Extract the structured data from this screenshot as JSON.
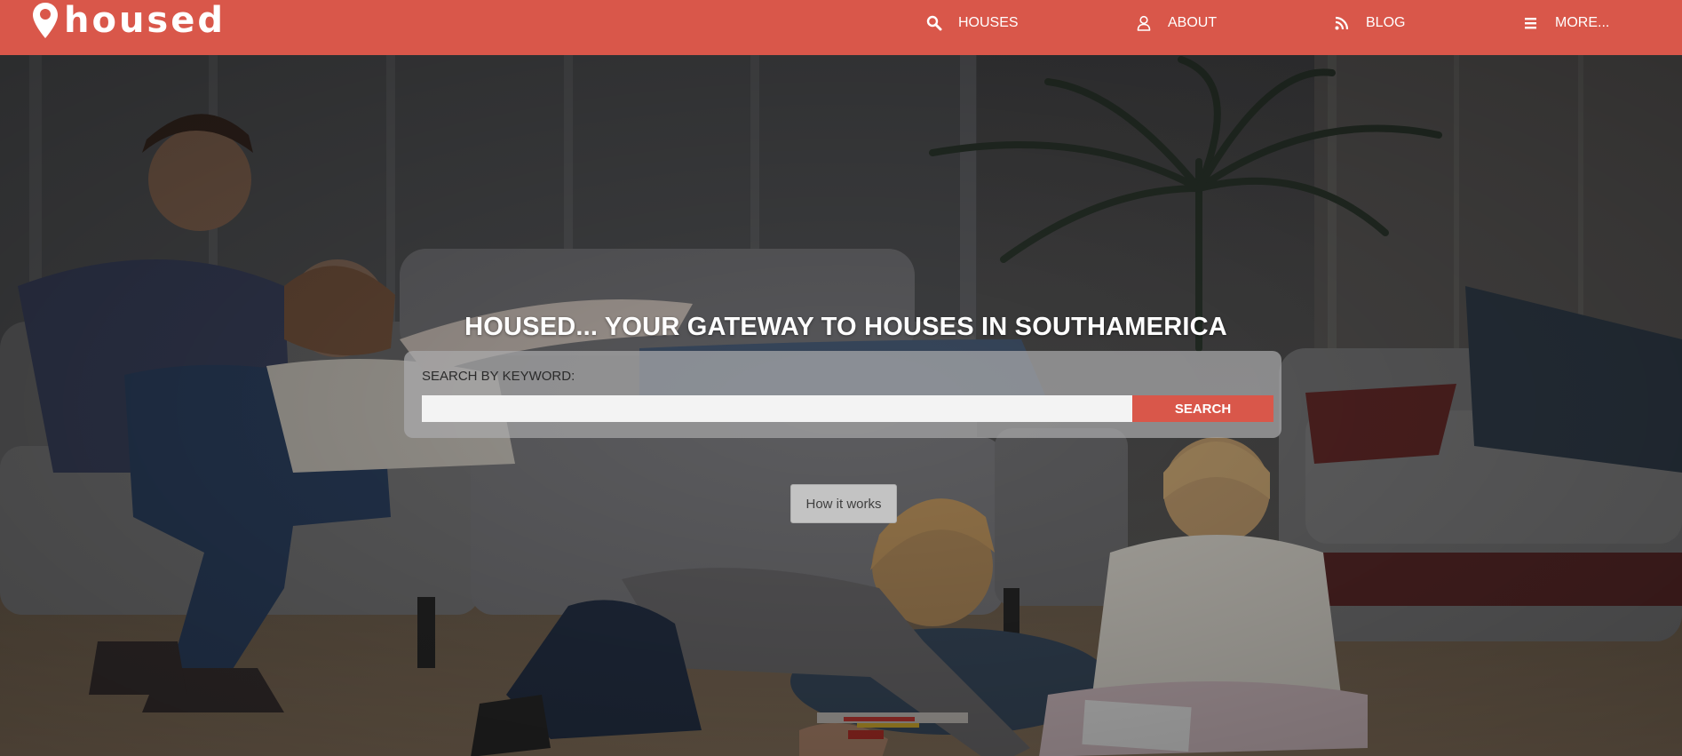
{
  "brand": {
    "name": "housed",
    "icon": "map-pin-icon",
    "accent_color": "#d9574a"
  },
  "nav": {
    "items": [
      {
        "label": "HOUSES",
        "icon": "search-icon"
      },
      {
        "label": "ABOUT",
        "icon": "user-icon"
      },
      {
        "label": "BLOG",
        "icon": "rss-icon"
      },
      {
        "label": "MORE...",
        "icon": "menu-icon"
      }
    ]
  },
  "hero": {
    "title": "HOUSED... YOUR GATEWAY TO HOUSES IN SOUTHAMERICA",
    "background": "photo-family-living-room"
  },
  "search": {
    "label": "SEARCH BY KEYWORD:",
    "value": "",
    "placeholder": "",
    "button_label": "SEARCH"
  },
  "how_it_works": {
    "label": "How it works"
  }
}
